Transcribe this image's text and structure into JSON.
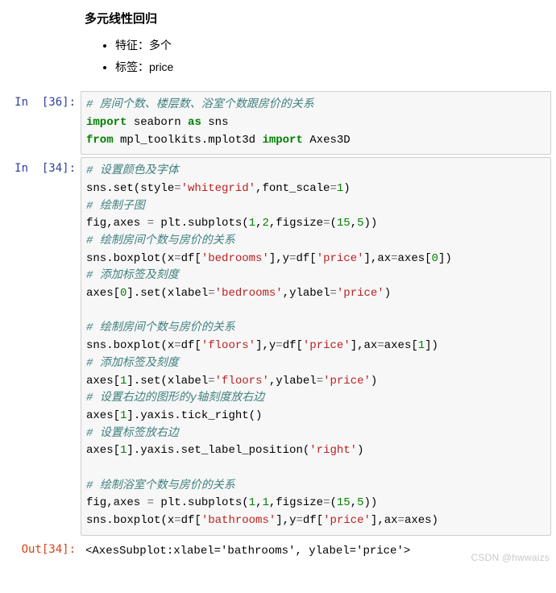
{
  "markdown": {
    "title": "多元线性回归",
    "bullets": [
      "特征：多个",
      "标签：price"
    ]
  },
  "cells": [
    {
      "prompt": "In  [36]:",
      "type": "in",
      "tokens": [
        {
          "c": "tk-c",
          "t": "# 房间个数、楼层数、浴室个数跟房价的关系"
        },
        {
          "t": "\n"
        },
        {
          "c": "tk-kw",
          "t": "import"
        },
        {
          "t": " seaborn "
        },
        {
          "c": "tk-kw",
          "t": "as"
        },
        {
          "t": " sns"
        },
        {
          "t": "\n"
        },
        {
          "c": "tk-kw",
          "t": "from"
        },
        {
          "t": " mpl_toolkits.mplot3d "
        },
        {
          "c": "tk-kw",
          "t": "import"
        },
        {
          "t": " Axes3D"
        }
      ]
    },
    {
      "prompt": "In  [34]:",
      "type": "in",
      "tokens": [
        {
          "c": "tk-c",
          "t": "# 设置颜色及字体"
        },
        {
          "t": "\n"
        },
        {
          "t": "sns.set(style"
        },
        {
          "c": "tk-op",
          "t": "="
        },
        {
          "c": "tk-s",
          "t": "'whitegrid'"
        },
        {
          "t": ",font_scale"
        },
        {
          "c": "tk-op",
          "t": "="
        },
        {
          "c": "tk-n",
          "t": "1"
        },
        {
          "t": ")"
        },
        {
          "t": "\n"
        },
        {
          "c": "tk-c",
          "t": "# 绘制子图"
        },
        {
          "t": "\n"
        },
        {
          "t": "fig,axes "
        },
        {
          "c": "tk-op",
          "t": "="
        },
        {
          "t": " plt.subplots("
        },
        {
          "c": "tk-n",
          "t": "1"
        },
        {
          "t": ","
        },
        {
          "c": "tk-n",
          "t": "2"
        },
        {
          "t": ",figsize"
        },
        {
          "c": "tk-op",
          "t": "="
        },
        {
          "t": "("
        },
        {
          "c": "tk-n",
          "t": "15"
        },
        {
          "t": ","
        },
        {
          "c": "tk-n",
          "t": "5"
        },
        {
          "t": "))"
        },
        {
          "t": "\n"
        },
        {
          "c": "tk-c",
          "t": "# 绘制房间个数与房价的关系"
        },
        {
          "t": "\n"
        },
        {
          "t": "sns.boxplot(x"
        },
        {
          "c": "tk-op",
          "t": "="
        },
        {
          "t": "df["
        },
        {
          "c": "tk-s",
          "t": "'bedrooms'"
        },
        {
          "t": "],y"
        },
        {
          "c": "tk-op",
          "t": "="
        },
        {
          "t": "df["
        },
        {
          "c": "tk-s",
          "t": "'price'"
        },
        {
          "t": "],ax"
        },
        {
          "c": "tk-op",
          "t": "="
        },
        {
          "t": "axes["
        },
        {
          "c": "tk-n",
          "t": "0"
        },
        {
          "t": "])"
        },
        {
          "t": "\n"
        },
        {
          "c": "tk-c",
          "t": "# 添加标签及刻度"
        },
        {
          "t": "\n"
        },
        {
          "t": "axes["
        },
        {
          "c": "tk-n",
          "t": "0"
        },
        {
          "t": "].set(xlabel"
        },
        {
          "c": "tk-op",
          "t": "="
        },
        {
          "c": "tk-s",
          "t": "'bedrooms'"
        },
        {
          "t": ",ylabel"
        },
        {
          "c": "tk-op",
          "t": "="
        },
        {
          "c": "tk-s",
          "t": "'price'"
        },
        {
          "t": ")"
        },
        {
          "t": "\n"
        },
        {
          "t": "\n"
        },
        {
          "c": "tk-c",
          "t": "# 绘制房间个数与房价的关系"
        },
        {
          "t": "\n"
        },
        {
          "t": "sns.boxplot(x"
        },
        {
          "c": "tk-op",
          "t": "="
        },
        {
          "t": "df["
        },
        {
          "c": "tk-s",
          "t": "'floors'"
        },
        {
          "t": "],y"
        },
        {
          "c": "tk-op",
          "t": "="
        },
        {
          "t": "df["
        },
        {
          "c": "tk-s",
          "t": "'price'"
        },
        {
          "t": "],ax"
        },
        {
          "c": "tk-op",
          "t": "="
        },
        {
          "t": "axes["
        },
        {
          "c": "tk-n",
          "t": "1"
        },
        {
          "t": "])"
        },
        {
          "t": "\n"
        },
        {
          "c": "tk-c",
          "t": "# 添加标签及刻度"
        },
        {
          "t": "\n"
        },
        {
          "t": "axes["
        },
        {
          "c": "tk-n",
          "t": "1"
        },
        {
          "t": "].set(xlabel"
        },
        {
          "c": "tk-op",
          "t": "="
        },
        {
          "c": "tk-s",
          "t": "'floors'"
        },
        {
          "t": ",ylabel"
        },
        {
          "c": "tk-op",
          "t": "="
        },
        {
          "c": "tk-s",
          "t": "'price'"
        },
        {
          "t": ")"
        },
        {
          "t": "\n"
        },
        {
          "c": "tk-c",
          "t": "# 设置右边的图形的y轴刻度放右边"
        },
        {
          "t": "\n"
        },
        {
          "t": "axes["
        },
        {
          "c": "tk-n",
          "t": "1"
        },
        {
          "t": "].yaxis.tick_right()"
        },
        {
          "t": "\n"
        },
        {
          "c": "tk-c",
          "t": "# 设置标签放右边"
        },
        {
          "t": "\n"
        },
        {
          "t": "axes["
        },
        {
          "c": "tk-n",
          "t": "1"
        },
        {
          "t": "].yaxis.set_label_position("
        },
        {
          "c": "tk-s",
          "t": "'right'"
        },
        {
          "t": ")"
        },
        {
          "t": "\n"
        },
        {
          "t": "\n"
        },
        {
          "c": "tk-c",
          "t": "# 绘制浴室个数与房价的关系"
        },
        {
          "t": "\n"
        },
        {
          "t": "fig,axes "
        },
        {
          "c": "tk-op",
          "t": "="
        },
        {
          "t": " plt.subplots("
        },
        {
          "c": "tk-n",
          "t": "1"
        },
        {
          "t": ","
        },
        {
          "c": "tk-n",
          "t": "1"
        },
        {
          "t": ",figsize"
        },
        {
          "c": "tk-op",
          "t": "="
        },
        {
          "t": "("
        },
        {
          "c": "tk-n",
          "t": "15"
        },
        {
          "t": ","
        },
        {
          "c": "tk-n",
          "t": "5"
        },
        {
          "t": "))"
        },
        {
          "t": "\n"
        },
        {
          "t": "sns.boxplot(x"
        },
        {
          "c": "tk-op",
          "t": "="
        },
        {
          "t": "df["
        },
        {
          "c": "tk-s",
          "t": "'bathrooms'"
        },
        {
          "t": "],y"
        },
        {
          "c": "tk-op",
          "t": "="
        },
        {
          "t": "df["
        },
        {
          "c": "tk-s",
          "t": "'price'"
        },
        {
          "t": "],ax"
        },
        {
          "c": "tk-op",
          "t": "="
        },
        {
          "t": "axes)"
        }
      ]
    },
    {
      "prompt": "Out[34]:",
      "type": "out",
      "text": "<AxesSubplot:xlabel='bathrooms', ylabel='price'>"
    }
  ],
  "watermark": "CSDN @hwwaizs"
}
